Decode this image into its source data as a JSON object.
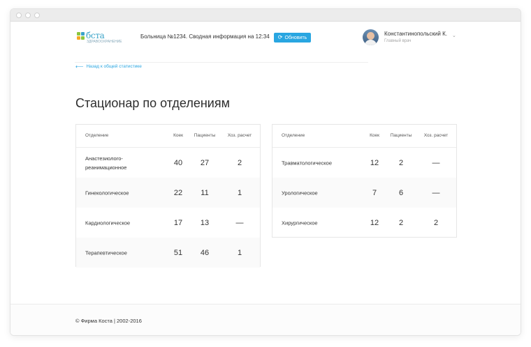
{
  "header": {
    "logo_text": "бста",
    "logo_sub": "ЗДРАВООХРАНЕНИЕ",
    "hospital_info": "Больница №1234. Сводная информация на 12:34",
    "refresh_label": "Обновить",
    "user_name": "Константинопольский К.",
    "user_role": "Главный врач"
  },
  "back_link": "Назад к общей статистике",
  "page_title": "Стационар по отделениям",
  "columns": {
    "department": "Отделение",
    "beds": "Коек",
    "patients": "Пациенты",
    "self_pay": "Хоз. расчет"
  },
  "left_table": [
    {
      "name": "Анастезиолого-реанимационное",
      "beds": "40",
      "patients": "27",
      "self_pay": "2"
    },
    {
      "name": "Гинекологическое",
      "beds": "22",
      "patients": "11",
      "self_pay": "1"
    },
    {
      "name": "Кардиологическое",
      "beds": "17",
      "patients": "13",
      "self_pay": "—"
    },
    {
      "name": "Терапевтическое",
      "beds": "51",
      "patients": "46",
      "self_pay": "1"
    }
  ],
  "right_table": [
    {
      "name": "Травматологическое",
      "beds": "12",
      "patients": "2",
      "self_pay": "—"
    },
    {
      "name": "Урологическое",
      "beds": "7",
      "patients": "6",
      "self_pay": "—"
    },
    {
      "name": "Хирургическое",
      "beds": "12",
      "patients": "2",
      "self_pay": "2"
    }
  ],
  "footer": "© Фирма Коста | 2002-2016",
  "colors": {
    "accent": "#29a6e1",
    "logo_green": "#8cc63f",
    "logo_blue": "#3aa3c8",
    "logo_orange": "#f7a823"
  }
}
